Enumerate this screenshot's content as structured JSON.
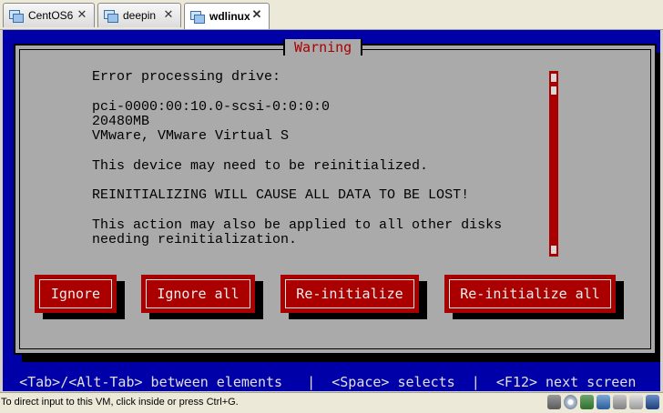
{
  "tabs": [
    {
      "label": "CentOS6",
      "active": false
    },
    {
      "label": "deepin",
      "active": false
    },
    {
      "label": "wdlinux",
      "active": true
    }
  ],
  "dialog": {
    "title": "Warning",
    "lines": [
      "Error processing drive:",
      "",
      "pci-0000:00:10.0-scsi-0:0:0:0",
      "20480MB",
      "VMware, VMware Virtual S",
      "",
      "This device may need to be reinitialized.",
      "",
      "REINITIALIZING WILL CAUSE ALL DATA TO BE LOST!",
      "",
      "This action may also be applied to all other disks",
      "needing reinitialization."
    ],
    "buttons": {
      "ignore": "Ignore",
      "ignore_all": "Ignore all",
      "reinitialize": "Re-initialize",
      "reinitialize_all": "Re-initialize all"
    }
  },
  "help_line": "<Tab>/<Alt-Tab> between elements   |  <Space> selects  |  <F12> next screen",
  "status": "To direct input to this VM, click inside or press Ctrl+G.",
  "tray_icons": [
    "hard-disk-icon",
    "cdrom-icon",
    "network-icon",
    "usb-icon",
    "sound-icon",
    "printer-icon",
    "display-icon"
  ],
  "colors": {
    "console_bg": "#0000a8",
    "dialog_bg": "#aaaaaa",
    "accent_red": "#aa0000"
  }
}
